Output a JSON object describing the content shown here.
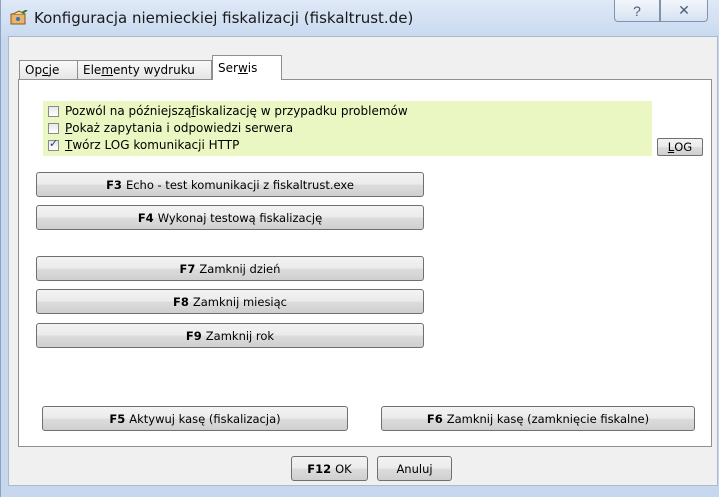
{
  "window": {
    "title": "Konfiguracja niemieckiej fiskalizacji (fiskaltrust.de)",
    "help_symbol": "?",
    "close_symbol": "✕"
  },
  "tabs": [
    {
      "label_pre": "Op",
      "label_u": "c",
      "label_post": "je"
    },
    {
      "label_pre": "Ele",
      "label_u": "m",
      "label_post": "enty wydruku"
    },
    {
      "label_pre": "Ser",
      "label_u": "w",
      "label_post": "is"
    }
  ],
  "options": [
    {
      "label_pre": "Pozwól na późniejszą ",
      "label_u": "f",
      "label_post": "iskalizację w przypadku problemów",
      "checked": false
    },
    {
      "label_pre": "",
      "label_u": "P",
      "label_post": "okaż zapytania i odpowiedzi serwera",
      "checked": false
    },
    {
      "label_pre": "",
      "label_u": "T",
      "label_post": "wórz LOG komunikacji HTTP",
      "checked": true
    }
  ],
  "log_button": {
    "label_u": "L",
    "label_post": "OG"
  },
  "service_buttons": [
    {
      "key": "F3",
      "label": "Echo - test komunikacji z fiskaltrust.exe"
    },
    {
      "key": "F4",
      "label": "Wykonaj testową fiskalizację"
    },
    {
      "key": "F7",
      "label": "Zamknij dzień"
    },
    {
      "key": "F8",
      "label": "Zamknij miesiąc"
    },
    {
      "key": "F9",
      "label": "Zamknij rok"
    }
  ],
  "register_buttons": [
    {
      "key": "F5",
      "label": "Aktywuj kasę (fiskalizacja)"
    },
    {
      "key": "F6",
      "label": "Zamknij kasę (zamknięcie fiskalne)"
    }
  ],
  "footer": {
    "ok_key": "F12",
    "ok_label": "OK",
    "cancel_label": "Anuluj"
  }
}
